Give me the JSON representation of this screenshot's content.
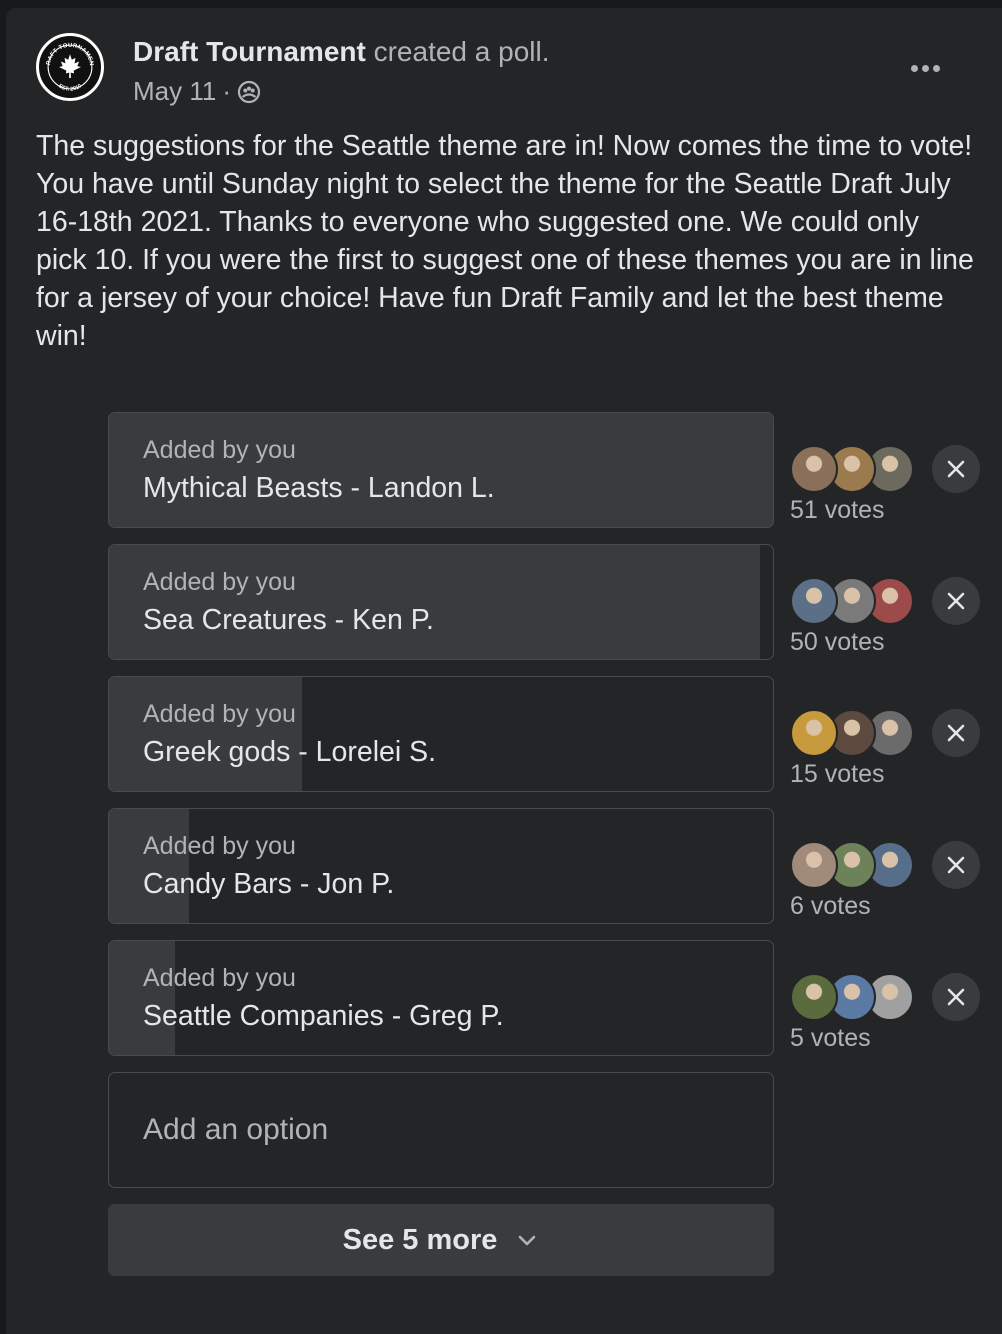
{
  "post": {
    "author": "Draft Tournament",
    "action": "created a poll.",
    "date": "May 11",
    "separator": "·",
    "privacy_icon": "group-icon",
    "avatar_logo": {
      "arc_top": "DRAFT TOURNAMENT",
      "arc_bottom": "EST. 2010"
    },
    "text": "The suggestions for the Seattle theme are in! Now comes the time to vote! You have until Sunday night to select the theme for the Seattle Draft July 16-18th 2021. Thanks to everyone who suggested one. We could only pick 10. If you were the first to suggest one of these themes you are in line for a jersey of your choice! Have fun Draft Family and let the best theme win!"
  },
  "poll": {
    "options": [
      {
        "added_by": "Added by you",
        "label": "Mythical Beasts - Landon L.",
        "votes": "51 votes",
        "fill_fraction": 1.0,
        "voter_colors": [
          "#8a6f5a",
          "#9b7b4e",
          "#6c6a5f"
        ]
      },
      {
        "added_by": "Added by you",
        "label": "Sea Creatures - Ken P.",
        "votes": "50 votes",
        "fill_fraction": 0.98,
        "voter_colors": [
          "#5b6f86",
          "#7a7a7a",
          "#9c4a4a"
        ]
      },
      {
        "added_by": "Added by you",
        "label": "Greek gods - Lorelei S.",
        "votes": "15 votes",
        "fill_fraction": 0.29,
        "voter_colors": [
          "#c79a3d",
          "#5c4a3f",
          "#6b6b6b"
        ]
      },
      {
        "added_by": "Added by you",
        "label": "Candy Bars - Jon P.",
        "votes": "6 votes",
        "fill_fraction": 0.12,
        "voter_colors": [
          "#a08a7a",
          "#6e8259",
          "#566e8a"
        ]
      },
      {
        "added_by": "Added by you",
        "label": "Seattle Companies - Greg P.",
        "votes": "5 votes",
        "fill_fraction": 0.1,
        "voter_colors": [
          "#5a6b3e",
          "#5a7aa3",
          "#a0a0a0"
        ]
      }
    ],
    "add_option_placeholder": "Add an option",
    "see_more_label": "See 5 more"
  },
  "colors": {
    "background": "#18191a",
    "card": "#242526",
    "poll_fill": "#3a3b3c",
    "primary_text": "#e4e6eb",
    "secondary_text": "#b0b3b8"
  }
}
